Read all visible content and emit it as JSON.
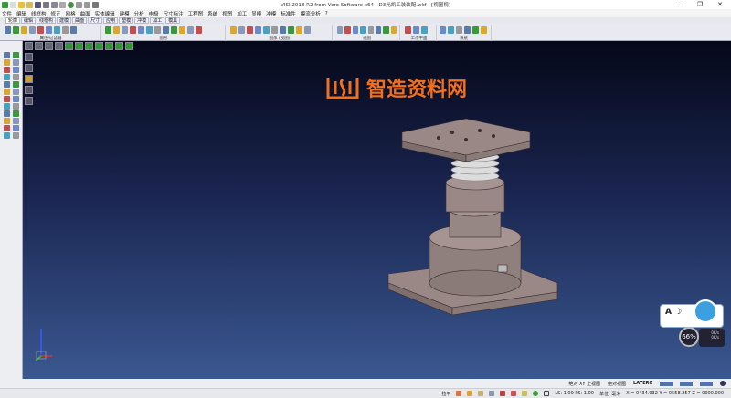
{
  "window": {
    "title": "VISI 2018 R2 from Vero Software x64 - D3光凯工装装配.wkf - [视图视]",
    "minimize": "—",
    "maximize": "❐",
    "close": "✕"
  },
  "menu": [
    "文件",
    "编辑",
    "线框构",
    "修正",
    "网格",
    "曲面",
    "实体编辑",
    "建模",
    "分析",
    "电极",
    "尺寸标注",
    "工程图",
    "系统",
    "视图",
    "加工",
    "显模",
    "冲模",
    "标准件",
    "模流分析",
    "?"
  ],
  "tabs": [
    "轮廓",
    "编辑",
    "线框构",
    "建模",
    "曲面",
    "尺寸",
    "应用",
    "塑模",
    "冲模",
    "加工",
    "模具"
  ],
  "ribbon_groups": [
    {
      "label": "属性/过滤器"
    },
    {
      "label": "图形"
    },
    {
      "label": "图像 (视图)"
    },
    {
      "label": "视图"
    },
    {
      "label": "工作平面"
    },
    {
      "label": "系统"
    }
  ],
  "watermark": "智造资料网",
  "status": {
    "view": "绝对 XY 上视图",
    "abs_view": "绝对视图",
    "layer": "LAYER0",
    "mode": "拉平",
    "scale": "LS: 1.00 PS: 1.00",
    "unit": "单位: 毫米",
    "coords": "X = 0434.932 Y = 0558.257 Z = 0000.000"
  },
  "widget": {
    "percent": "66%",
    "up": "0K/s",
    "down": "0K/s"
  },
  "colors": {
    "viewport_top": "#050818",
    "viewport_bottom": "#3a5890",
    "model": "#9a8886",
    "watermark": "#f07020"
  }
}
